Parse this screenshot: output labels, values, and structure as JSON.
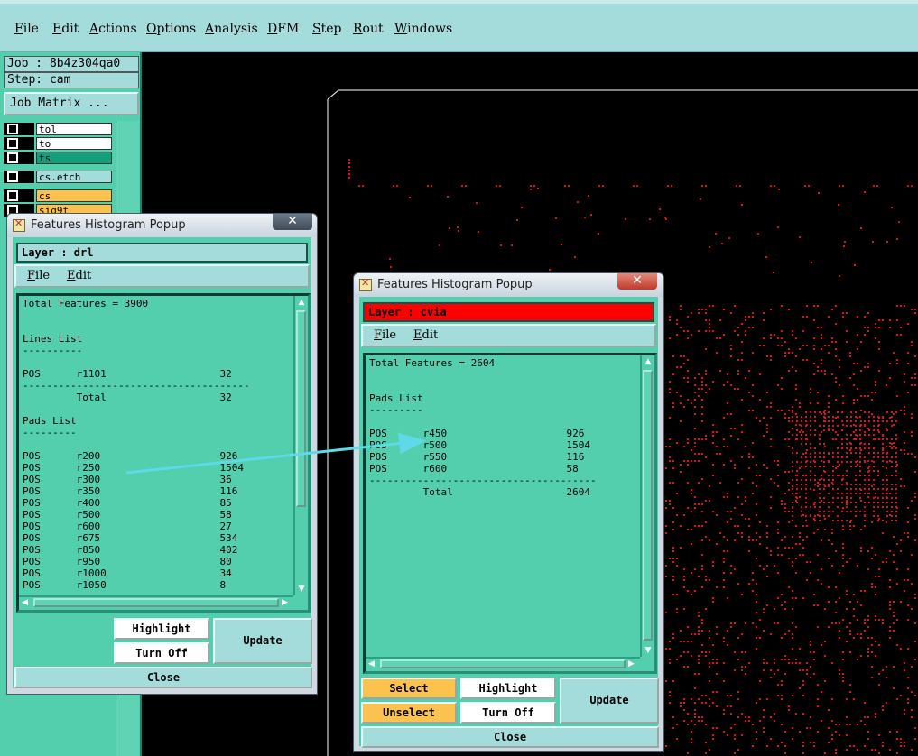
{
  "menubar": {
    "items": [
      "File",
      "Edit",
      "Actions",
      "Options",
      "Analysis",
      "DFM",
      "Step",
      "Rout",
      "Windows"
    ]
  },
  "left_panel": {
    "job": "Job : 8b4z304qa0",
    "step": "Step: cam",
    "job_matrix": "Job Matrix ...",
    "layers": [
      {
        "name": "tol",
        "color": "#ffffff"
      },
      {
        "name": "to",
        "color": "#ffffff"
      },
      {
        "name": "ts",
        "color": "#12a07a"
      },
      {
        "name": "cs.etch",
        "color": "#a3dcda"
      },
      {
        "name": "cs",
        "color": "#fcc24e"
      },
      {
        "name": "sig9t",
        "color": "#fcc24e"
      }
    ]
  },
  "popup1": {
    "title": "Features Histogram Popup",
    "layer": "Layer :  drl",
    "layer_bg": "#a3dcda",
    "menu": {
      "file": "File",
      "edit": "Edit"
    },
    "list_lines": [
      "Total Features = 3900",
      "",
      "",
      "Lines List",
      "----------",
      "",
      "POS      r1101                   32",
      "--------------------------------------",
      "         Total                   32",
      "",
      "Pads List",
      "---------",
      "",
      "POS      r200                    926",
      "POS      r250                    1504",
      "POS      r300                    36",
      "POS      r350                    116",
      "POS      r400                    85",
      "POS      r500                    58",
      "POS      r600                    27",
      "POS      r675                    534",
      "POS      r850                    402",
      "POS      r950                    80",
      "POS      r1000                   34",
      "POS      r1050                   8"
    ],
    "buttons": {
      "highlight": "Highlight",
      "turn_off": "Turn Off",
      "update": "Update",
      "close": "Close"
    }
  },
  "popup2": {
    "title": "Features Histogram Popup",
    "layer": "Layer :  cvia",
    "layer_bg": "#ff0000",
    "menu": {
      "file": "File",
      "edit": "Edit"
    },
    "list_lines": [
      "Total Features = 2604",
      "",
      "",
      "Pads List",
      "---------",
      "",
      "POS      r450                    926",
      "POS      r500                    1504",
      "POS      r550                    116",
      "POS      r600                    58",
      "--------------------------------------",
      "         Total                   2604"
    ],
    "buttons": {
      "select": "Select",
      "unselect": "Unselect",
      "highlight": "Highlight",
      "turn_off": "Turn Off",
      "update": "Update",
      "close": "Close"
    }
  },
  "colors": {
    "panel": "#53cfad",
    "menu": "#a3dcda",
    "canvas_features": "#e0101a",
    "arrow": "#5fd8e8"
  }
}
